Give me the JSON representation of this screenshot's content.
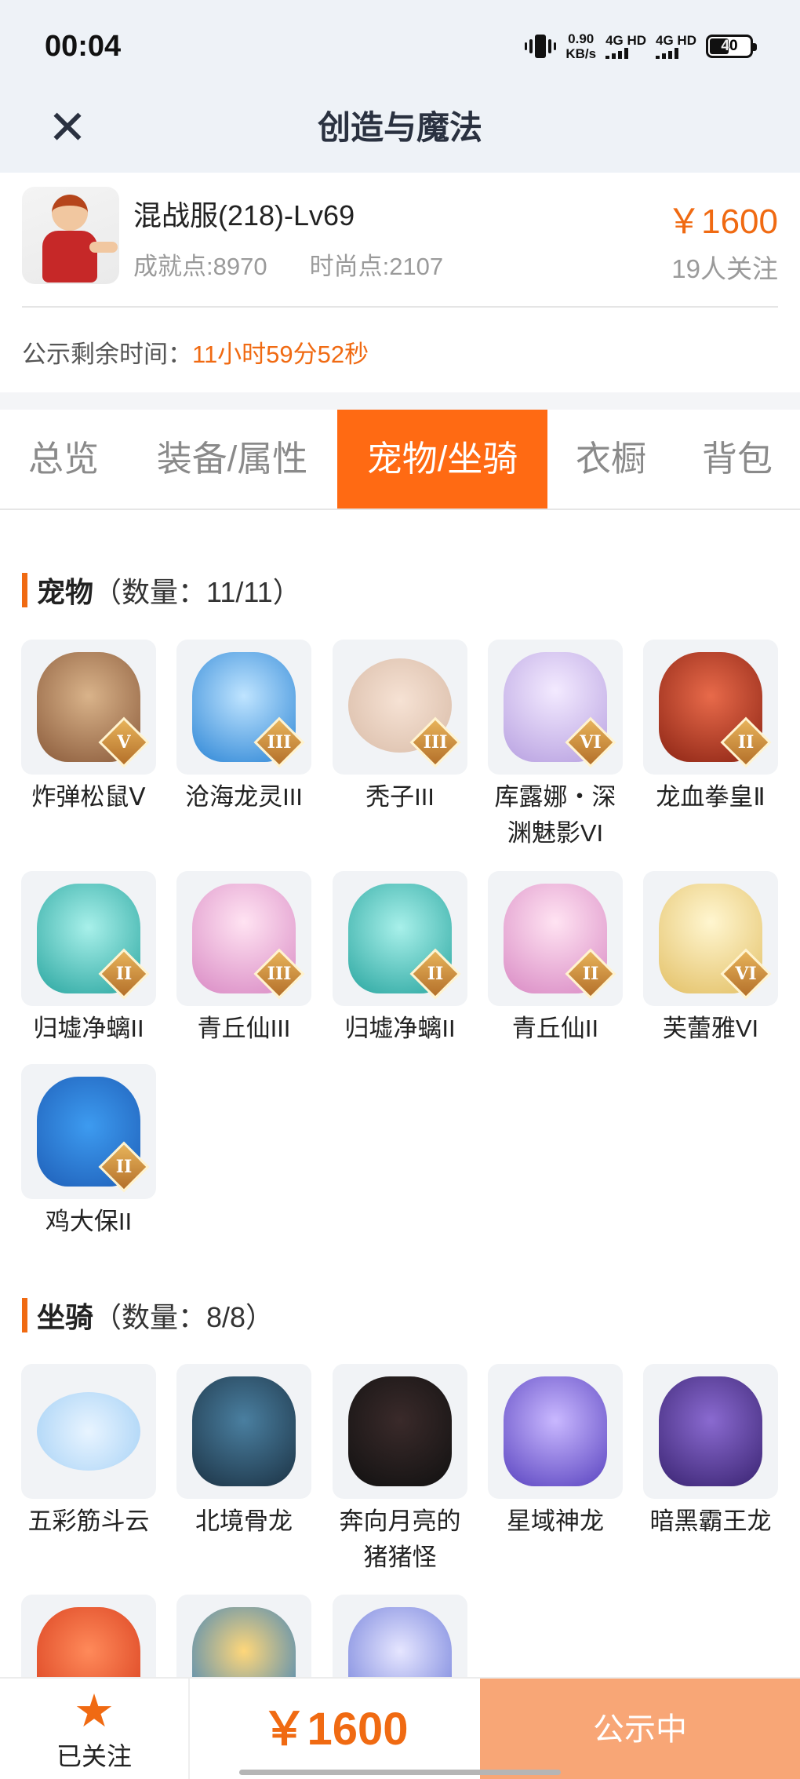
{
  "status_bar": {
    "time": "00:04",
    "net_speed_value": "0.90",
    "net_speed_unit": "KB/s",
    "sim1": "4G HD",
    "sim2": "4G HD",
    "battery": "40"
  },
  "nav": {
    "close_icon": "close-icon",
    "title": "创造与魔法"
  },
  "product": {
    "server": "混战服(218)-Lv69",
    "achievement": "成就点:8970",
    "fashion": "时尚点:2107",
    "price": "￥1600",
    "followers": "19人关注",
    "remaining_label": "公示剩余时间：",
    "remaining_value": "11小时59分52秒"
  },
  "tabs": [
    {
      "label": "总览"
    },
    {
      "label": "装备/属性"
    },
    {
      "label": "宠物/坐骑",
      "active": true
    },
    {
      "label": "衣橱"
    },
    {
      "label": "背包"
    }
  ],
  "pets": {
    "title": "宠物",
    "count": "（数量：11/11）",
    "items": [
      {
        "name": "炸弹松鼠Ⅴ",
        "rank": "V"
      },
      {
        "name": "沧海龙灵III",
        "rank": "III"
      },
      {
        "name": "秃子III",
        "rank": "III"
      },
      {
        "name": "库露娜・深渊魅影VI",
        "rank": "VI"
      },
      {
        "name": "龙血拳皇Ⅱ",
        "rank": "II"
      },
      {
        "name": "归墟净螭II",
        "rank": "II"
      },
      {
        "name": "青丘仙III",
        "rank": "III"
      },
      {
        "name": "归墟净螭II",
        "rank": "II"
      },
      {
        "name": "青丘仙II",
        "rank": "II"
      },
      {
        "name": "芙蕾雅VI",
        "rank": "VI"
      },
      {
        "name": "鸡大保II",
        "rank": "II"
      }
    ]
  },
  "mounts": {
    "title": "坐骑",
    "count": "（数量：8/8）",
    "items": [
      {
        "name": "五彩筋斗云"
      },
      {
        "name": "北境骨龙"
      },
      {
        "name": "奔向月亮的猪猪怪"
      },
      {
        "name": "星域神龙"
      },
      {
        "name": "暗黑霸王龙"
      }
    ]
  },
  "bottom": {
    "follow_label": "已关注",
    "price": "￥1600",
    "status_button": "公示中"
  },
  "colors": {
    "accent": "#ff6a13",
    "price": "#f06a12",
    "button_disabled": "#f8a676"
  }
}
